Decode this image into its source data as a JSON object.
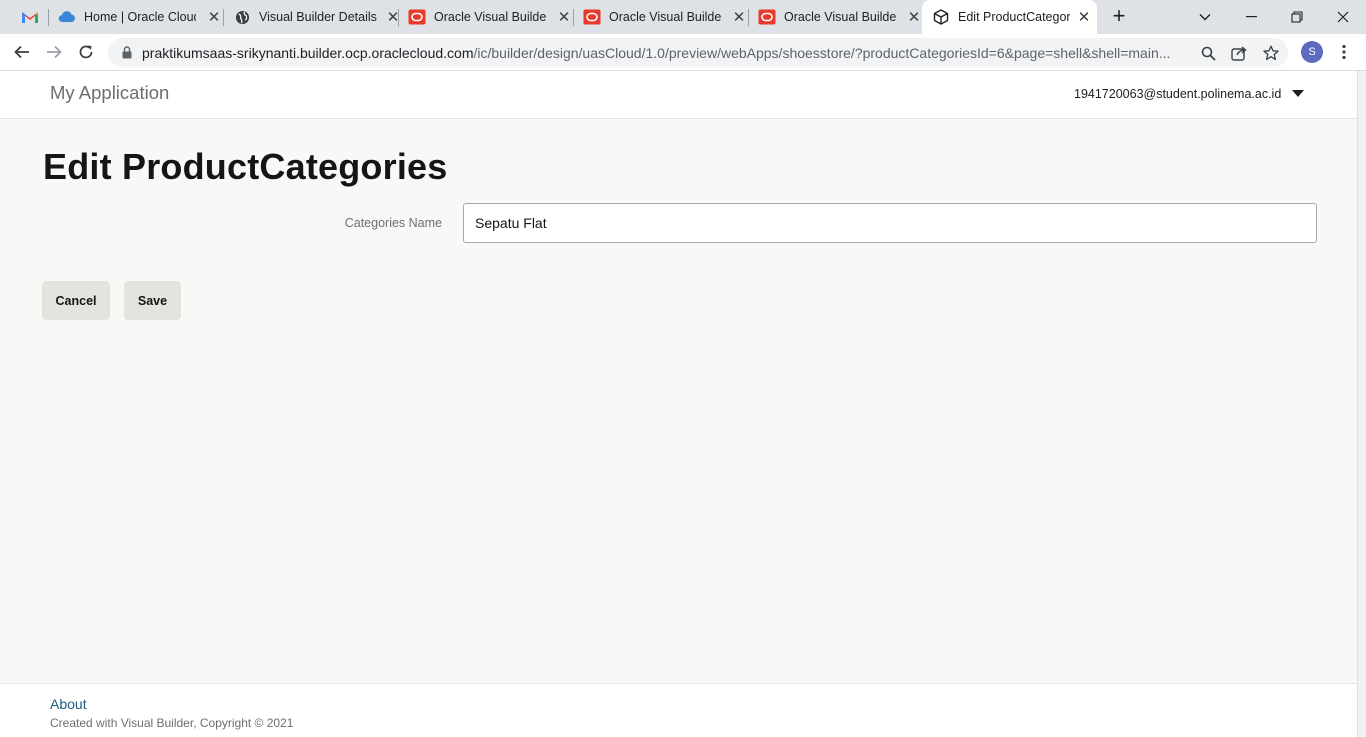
{
  "browser": {
    "tabs": [
      {
        "title": "",
        "icon": "gmail-icon"
      },
      {
        "title": "Home | Oracle Cloud",
        "icon": "cloud-icon"
      },
      {
        "title": "Visual Builder Details",
        "icon": "globe-icon"
      },
      {
        "title": "Oracle Visual Builder",
        "icon": "oracle-icon"
      },
      {
        "title": "Oracle Visual Builder",
        "icon": "oracle-icon"
      },
      {
        "title": "Oracle Visual Builder",
        "icon": "oracle-icon"
      },
      {
        "title": "Edit ProductCategories",
        "icon": "cube-icon",
        "active": true
      }
    ],
    "url_host": "praktikumsaas-srikynanti.builder.ocp.oraclecloud.com",
    "url_path": "/ic/builder/design/uasCloud/1.0/preview/webApps/shoesstore/?productCategoriesId=6&page=shell&shell=main...",
    "profile_initial": "S"
  },
  "header": {
    "app_title": "My Application",
    "user_email": "1941720063@student.polinema.ac.id"
  },
  "main": {
    "page_title": "Edit ProductCategories",
    "field_label": "Categories Name",
    "field_value": "Sepatu Flat",
    "cancel_label": "Cancel",
    "save_label": "Save"
  },
  "footer": {
    "about_label": "About",
    "copyright": "Created with Visual Builder, Copyright © 2021"
  },
  "colors": {
    "accent_oracle": "#e8392a",
    "link": "#1f5d7e",
    "button_bg": "#e5e3e0",
    "page_bg": "#f9f8f6"
  }
}
